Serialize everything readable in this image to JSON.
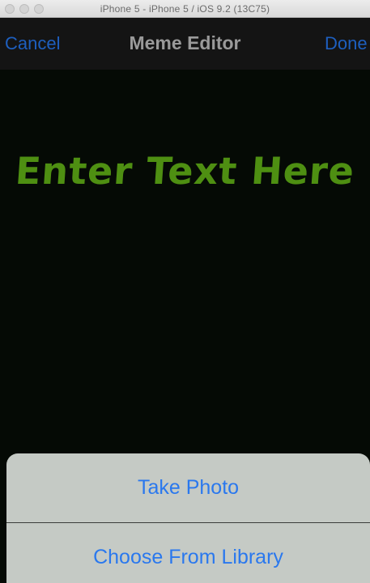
{
  "window": {
    "title": "iPhone 5 - iPhone 5 / iOS 9.2 (13C75)"
  },
  "navbar": {
    "cancel_label": "Cancel",
    "title": "Meme Editor",
    "done_label": "Done"
  },
  "canvas": {
    "meme_text": "Enter Text Here",
    "text_color": "#4e8f12",
    "background_color": "#050a05"
  },
  "action_sheet": {
    "items": [
      {
        "label": "Take Photo"
      },
      {
        "label": "Choose From Library"
      }
    ],
    "text_color": "#2a78ee"
  }
}
